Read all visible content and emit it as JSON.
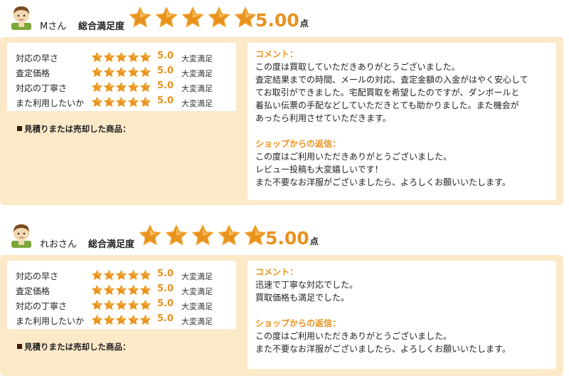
{
  "colors": {
    "accent": "#e8921e",
    "panel": "#fbe9c8"
  },
  "icons": {
    "avatar": "user-avatar-icon",
    "star": "star-icon"
  },
  "reviews": [
    {
      "user": "Mさん",
      "total_label": "総合満足度",
      "total_stars": 5,
      "total_score": "5.00",
      "total_unit": "点",
      "ratings": [
        {
          "label": "対応の早さ",
          "stars": 5,
          "value": "5.0",
          "text": "大変満足"
        },
        {
          "label": "査定価格",
          "stars": 5,
          "value": "5.0",
          "text": "大変満足"
        },
        {
          "label": "対応の丁寧さ",
          "stars": 5,
          "value": "5.0",
          "text": "大変満足"
        },
        {
          "label": "また利用したいか",
          "stars": 5,
          "value": "5.0",
          "text": "大変満足"
        }
      ],
      "goods_label": "見積りまたは売却した商品：",
      "comment_title": "コメント：",
      "comment": "この度は買取していただきありがとうございました。\n査定結果までの時間、メールの対応、査定金額の入金がはやく安心して\nてお取引ができました。宅配買取を希望したのですが、ダンボールと\n着払い伝票の手配などしていただきとても助かりました。また機会が\nあったら利用させていただきます。",
      "reply_title": "ショップからの返信：",
      "reply": "この度はご利用いただきありがとうございました。\nレビュー投稿も大変嬉しいです！\nまた不要なお洋服がございましたら、よろしくお願いいたします。"
    },
    {
      "user": "れおさん",
      "total_label": "総合満足度",
      "total_stars": 5,
      "total_score": "5.00",
      "total_unit": "点",
      "ratings": [
        {
          "label": "対応の早さ",
          "stars": 5,
          "value": "5.0",
          "text": "大変満足"
        },
        {
          "label": "査定価格",
          "stars": 5,
          "value": "5.0",
          "text": "大変満足"
        },
        {
          "label": "対応の丁寧さ",
          "stars": 5,
          "value": "5.0",
          "text": "大変満足"
        },
        {
          "label": "また利用したいか",
          "stars": 5,
          "value": "5.0",
          "text": "大変満足"
        }
      ],
      "goods_label": "見積りまたは売却した商品：",
      "comment_title": "コメント：",
      "comment": "迅速で丁寧な対応でした。\n買取価格も満足でした。",
      "reply_title": "ショップからの返信：",
      "reply": "この度はご利用いただきありがとうございました。\nまた不要なお洋服がございましたら、よろしくお願いいたします。"
    }
  ]
}
